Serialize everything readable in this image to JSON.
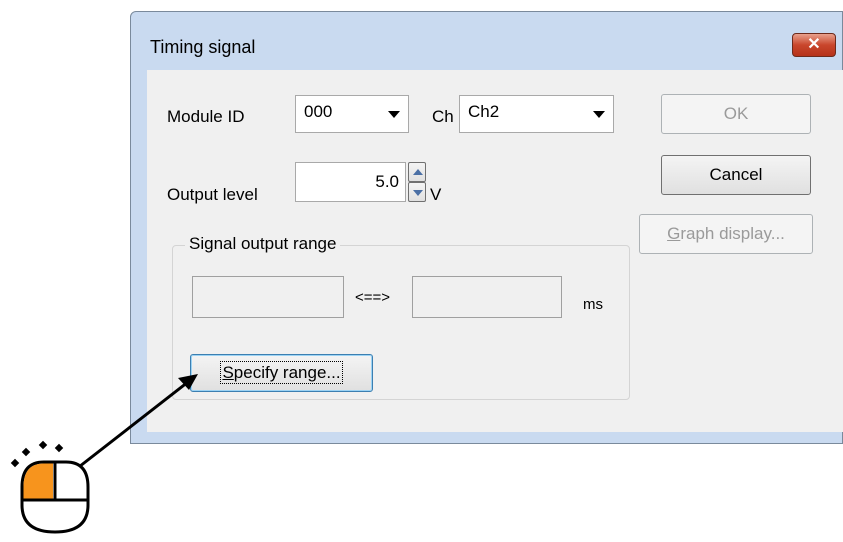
{
  "dialog": {
    "title": "Timing signal",
    "close_label": "✕"
  },
  "module": {
    "label": "Module ID",
    "value": "000"
  },
  "channel": {
    "label": "Ch",
    "value": "Ch2"
  },
  "output": {
    "label": "Output level",
    "value": "5.0",
    "unit": "V"
  },
  "range_group": {
    "title": "Signal output range",
    "start": "",
    "end": "",
    "separator": "<==>",
    "unit": "ms",
    "specify_label_first": "S",
    "specify_label_rest": "pecify range..."
  },
  "buttons": {
    "ok": "OK",
    "cancel": "Cancel",
    "graph_first": "G",
    "graph_rest": "raph display..."
  },
  "colors": {
    "frame": "#c9daf0",
    "close": "#c9462c",
    "cursor_accent": "#f7941d"
  }
}
